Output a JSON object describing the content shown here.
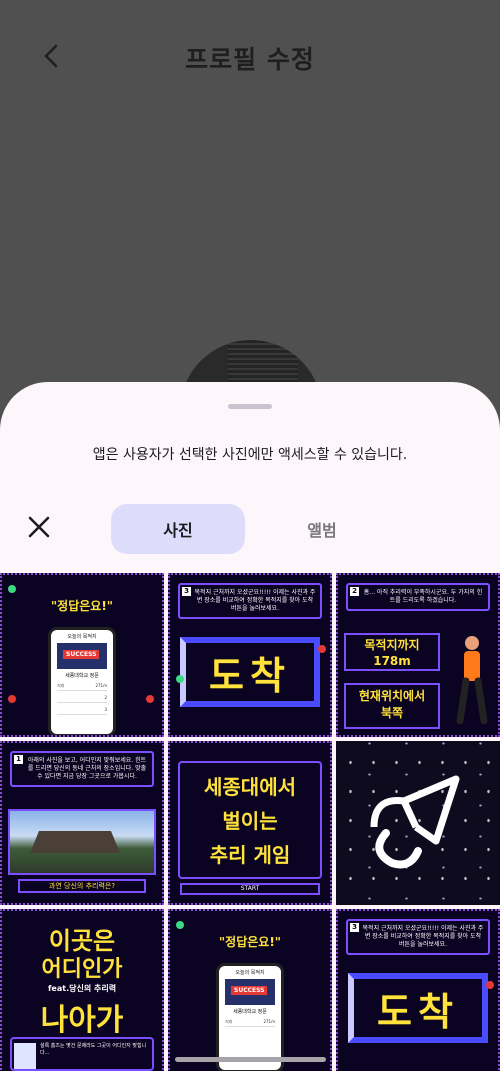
{
  "header": {
    "title": "프로필 수정"
  },
  "picker": {
    "notice": "앱은 사용자가 선택한 사진에만 액세스할 수 있습니다.",
    "tabs": {
      "photos": "사진",
      "album": "앨범"
    }
  },
  "photos": [
    {
      "quote": "\"정답은요!\"",
      "phone_title": "오늘의 목적지",
      "badge": "SUCCESS",
      "place": "세종대학교 정문",
      "rows": [
        "거리",
        "271m",
        "2",
        "3"
      ]
    },
    {
      "num": "3",
      "text": "목적지 근처까지 오셨군요!!!!! 이제는 사진과 주변 장소를 비교하여 정확한 목적지를 찾아 도착 버튼을 눌러보세요.",
      "big": "도착"
    },
    {
      "num": "2",
      "text": "흠... 아직 추리력이 부족하시군요. 두 가지의 힌트를 드리도록 하겠습니다.",
      "hint1": "목적지까지",
      "hint1b": "178m",
      "hint2": "현재위치에서",
      "hint2b": "북쪽"
    },
    {
      "num": "1",
      "text": "아래의 사진을 보고, 어디인지 맞춰보세요. 힌트를 드리면 당신의 동네 근처의 장소입니다. 맞출 수 있다면 지금 당장 그곳으로 가봅시다.",
      "label": "과연 당신의 추리력은?"
    },
    {
      "line1": "세종대에서",
      "line2": "벌이는",
      "line3": "추리 게임",
      "start": "START"
    },
    {
      "logo": "space-logo"
    },
    {
      "line1": "이곳은",
      "line2": "어디인가",
      "sub": "feat.당신의 추리력",
      "line3": "나아가",
      "caption": "설록 홈즈는 몇건 문제라도 그곳이 어디인지 맞힙니다..."
    },
    {
      "quote": "\"정답은요!\"",
      "phone_title": "오늘의 목적지",
      "badge": "SUCCESS",
      "place": "세종대학교 정문",
      "rows": [
        "거리",
        "271m"
      ]
    },
    {
      "num": "3",
      "text": "목적지 근처까지 오셨군요!!!!! 이제는 사진과 주변 장소를 비교하여 정확한 목적지를 찾아 도착 버튼을 눌러보세요.",
      "big": "도착"
    }
  ],
  "colors": {
    "sheet": "#fdf7fb",
    "tab_selected": "#dedcfb",
    "dim": "#505050",
    "neon_yellow": "#ffe23b",
    "neon_purple": "#7b4fff"
  }
}
